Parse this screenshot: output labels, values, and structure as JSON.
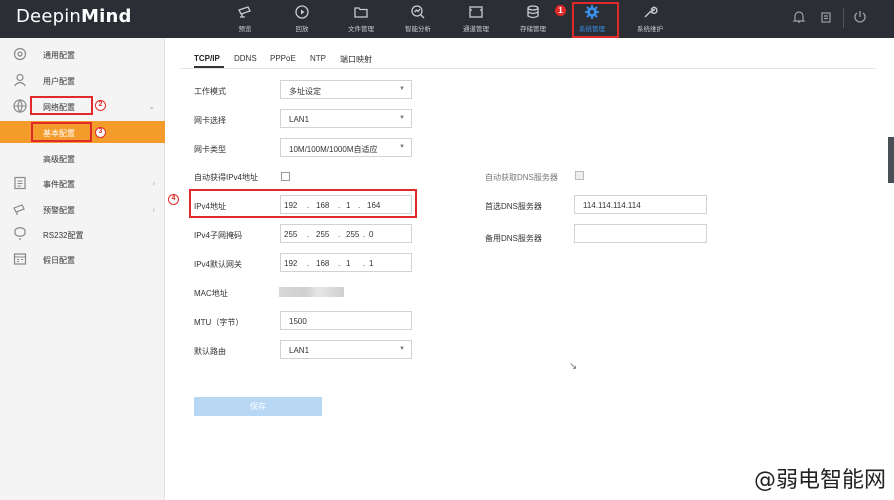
{
  "app": {
    "logo_bold": "Deepin",
    "logo_light": "Mind"
  },
  "nav": {
    "items": [
      {
        "label": "预览",
        "icon": "camera-icon"
      },
      {
        "label": "回放",
        "icon": "playback-icon"
      },
      {
        "label": "文件管理",
        "icon": "folder-icon"
      },
      {
        "label": "智能分析",
        "icon": "analysis-icon"
      },
      {
        "label": "通道管理",
        "icon": "channel-icon"
      },
      {
        "label": "存储管理",
        "icon": "database-icon"
      },
      {
        "label": "系统管理",
        "icon": "gear-icon"
      },
      {
        "label": "系统维护",
        "icon": "wrench-icon"
      }
    ],
    "active_color": "#3a8fe8"
  },
  "annotations": {
    "n1": "1",
    "n2": "2",
    "n3": "3",
    "n4": "4"
  },
  "sidebar": {
    "items": [
      {
        "label": "通用配置",
        "icon": "settings-icon"
      },
      {
        "label": "用户配置",
        "icon": "user-icon"
      },
      {
        "label": "网络配置",
        "icon": "globe-icon"
      },
      {
        "label": "事件配置",
        "icon": "event-icon"
      },
      {
        "label": "预警配置",
        "icon": "alarm-icon"
      },
      {
        "label": "RS232配置",
        "icon": "serial-icon"
      },
      {
        "label": "假日配置",
        "icon": "calendar-icon"
      }
    ],
    "sub": [
      {
        "label": "基本配置"
      },
      {
        "label": "高级配置"
      }
    ],
    "active_color": "#f39c2c"
  },
  "tabs": [
    "TCP/IP",
    "DDNS",
    "PPPoE",
    "NTP",
    "端口映射"
  ],
  "form": {
    "work_mode": {
      "label": "工作模式",
      "value": "多址设定"
    },
    "nic_select": {
      "label": "网卡选择",
      "value": "LAN1"
    },
    "nic_type": {
      "label": "网卡类型",
      "value": "10M/100M/1000M自适应"
    },
    "auto_ipv4": {
      "label": "自动获得IPv4地址"
    },
    "ipv4_addr": {
      "label": "IPv4地址",
      "seg": [
        "192",
        "168",
        "1",
        "164"
      ]
    },
    "ipv4_mask": {
      "label": "IPv4子网掩码",
      "seg": [
        "255",
        "255",
        "255",
        "0"
      ]
    },
    "ipv4_gw": {
      "label": "IPv4默认网关",
      "seg": [
        "192",
        "168",
        "1",
        "1"
      ]
    },
    "mac": {
      "label": "MAC地址"
    },
    "mtu": {
      "label": "MTU（字节）",
      "value": "1500"
    },
    "default_route": {
      "label": "默认路由",
      "value": "LAN1"
    },
    "auto_dns": {
      "label": "自动获取DNS服务器"
    },
    "pref_dns": {
      "label": "首选DNS服务器",
      "value": "114.114.114.114"
    },
    "alt_dns": {
      "label": "备用DNS服务器",
      "value": ""
    },
    "save": "保存"
  },
  "watermark": "@弱电智能网"
}
